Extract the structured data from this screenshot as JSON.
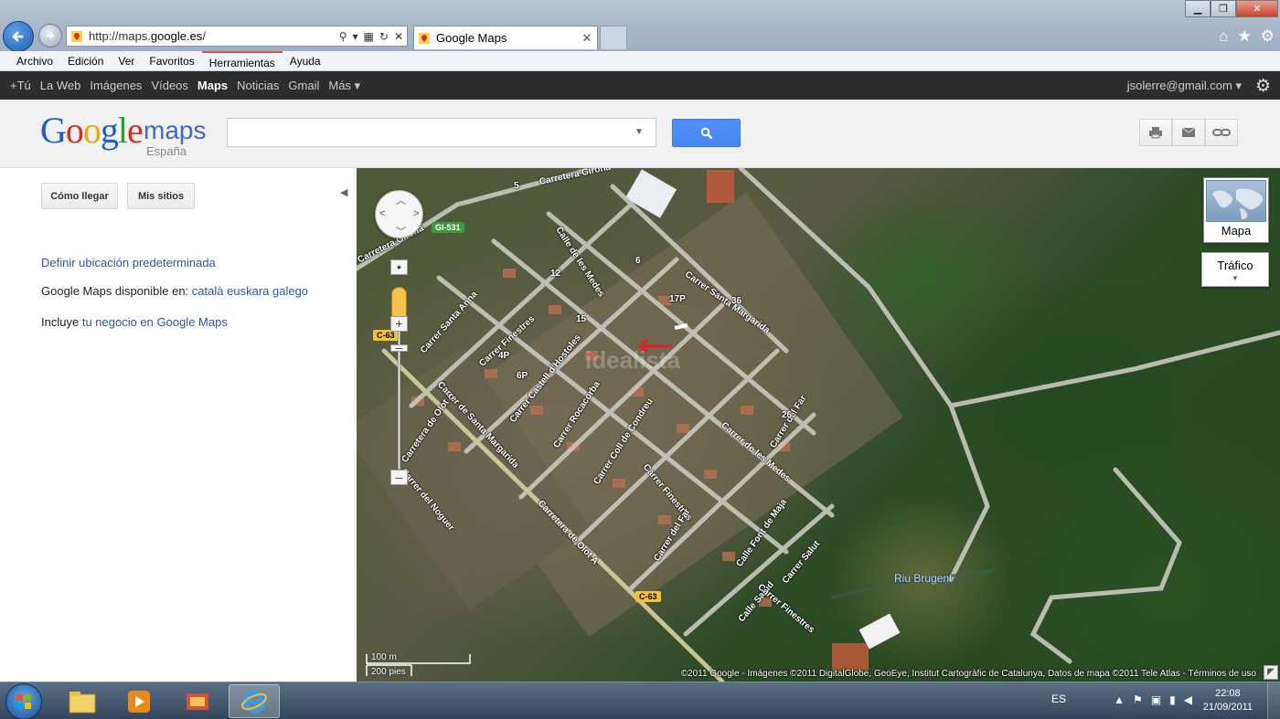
{
  "browser": {
    "url_prefix": "http://maps.",
    "url_domain": "google.es",
    "url_suffix": "/",
    "tab_title": "Google Maps",
    "menu": [
      "Archivo",
      "Edición",
      "Ver",
      "Favoritos",
      "Herramientas",
      "Ayuda"
    ]
  },
  "gbar": {
    "items": [
      "+Tú",
      "La Web",
      "Imágenes",
      "Vídeos",
      "Maps",
      "Noticias",
      "Gmail",
      "Más ▾"
    ],
    "selected": "Maps",
    "user": "jsolerre@gmail.com ▾"
  },
  "header": {
    "logo_letters": [
      "G",
      "o",
      "o",
      "g",
      "l",
      "e"
    ],
    "logo_maps": "maps",
    "logo_country": "España",
    "search_value": "",
    "search_placeholder": ""
  },
  "left_panel": {
    "directions_label": "Cómo llegar",
    "my_places_label": "Mis sitios",
    "default_location_link": "Definir ubicación predeterminada",
    "available_in_text": "Google Maps disponible en:",
    "languages": [
      "català",
      "euskara",
      "galego"
    ],
    "include_text": "Incluye",
    "business_link": "tu negocio en Google Maps"
  },
  "map": {
    "road_labels": [
      "Carretera Girona",
      "Carretera Girona",
      "Carrer Santa Anna",
      "Carrer Finestres",
      "Calle de les Medes",
      "Carrer Santa Margarida",
      "Carrer Castell d'Hostoles",
      "Carretera de Olot A",
      "Carrer de Santa Margarida",
      "Carrer Rocacorba",
      "Carrer Coll de Condreu",
      "Carrer de les Medes",
      "Carrer del Far",
      "Carrer Finestres",
      "Carrer del Far",
      "Calle Font de Maja",
      "Carrer Salut",
      "Carretera de Olot A",
      "Carrer del Noguer",
      "Calle Salud",
      "Carrer Finestres"
    ],
    "shields": {
      "gi531": "GI-531",
      "c63a": "C-63",
      "c63b": "C-63"
    },
    "house_numbers": [
      "5",
      "12",
      "6",
      "17P",
      "36",
      "15",
      "26",
      "6P",
      "4P"
    ],
    "river": "Riu Brugent",
    "watermark": "idealista",
    "map_type": "Mapa",
    "traffic": "Tráfico",
    "scale_m": "100 m",
    "scale_ft": "200 pies",
    "copyright": "©2011 Google - Imágenes ©2011 DigitalGlobe, GeoEye, Institut Cartogràfic de Catalunya, Datos de mapa ©2011 Tele Atlas - Términos de uso"
  },
  "taskbar": {
    "language": "ES",
    "time": "22:08",
    "date": "21/09/2011"
  },
  "colors": {
    "google_blue": "#1a5dd3",
    "google_red": "#d62d20",
    "google_yellow": "#f0a30a",
    "google_green": "#219f35",
    "link": "#2a55a6",
    "search_button": "#4d90fe",
    "gbar_bg": "#2d2d2d"
  }
}
